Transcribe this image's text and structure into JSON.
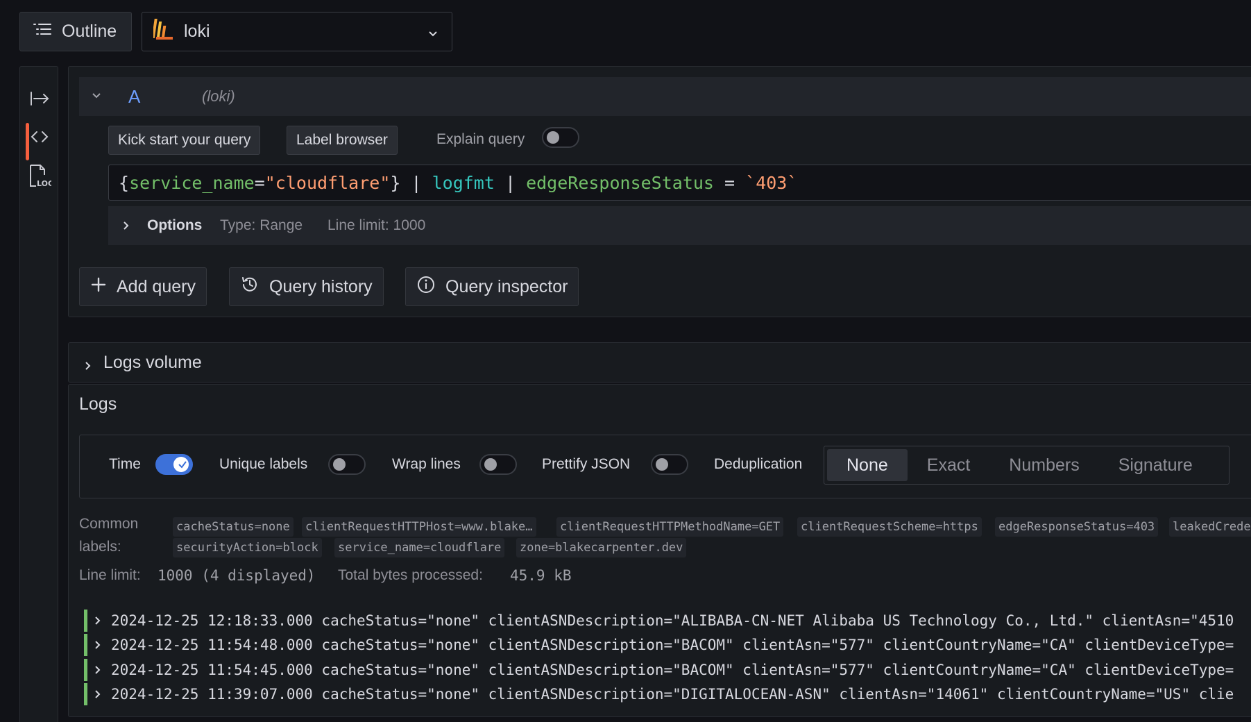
{
  "toolbar": {
    "outline_label": "Outline",
    "datasource": "loki"
  },
  "query": {
    "ref_id": "A",
    "datasource_label": "(loki)",
    "kick_start_label": "Kick start your query",
    "label_browser_label": "Label browser",
    "explain_label": "Explain query",
    "explain_on": false,
    "expr_parts": {
      "p1": "{",
      "label": "service_name",
      "p2": "=",
      "value": "\"cloudflare\"",
      "p3": "} | ",
      "fn": "logfmt",
      "p4": " | ",
      "field": "edgeResponseStatus",
      "p5": " = ",
      "cmp": "`403`"
    },
    "options_label": "Options",
    "options_type": "Type: Range",
    "options_limit": "Line limit: 1000"
  },
  "actions": {
    "add_query": "Add query",
    "query_history": "Query history",
    "query_inspector": "Query inspector"
  },
  "logs_volume": {
    "title": "Logs volume"
  },
  "logs": {
    "title": "Logs",
    "controls": {
      "time": "Time",
      "time_on": true,
      "unique_labels": "Unique labels",
      "wrap_lines": "Wrap lines",
      "prettify_json": "Prettify JSON",
      "deduplication": "Deduplication",
      "dedup_options": [
        "None",
        "Exact",
        "Numbers",
        "Signature"
      ],
      "dedup_selected": "None"
    },
    "common_labels_title_1": "Common",
    "common_labels_title_2": "labels:",
    "common_labels_row1": [
      "cacheStatus=none",
      "clientRequestHTTPHost=www.blake…",
      "clientRequestHTTPMethodName=GET",
      "clientRequestScheme=https",
      "edgeResponseStatus=403",
      "leakedCrede"
    ],
    "common_labels_row2": [
      "securityAction=block",
      "service_name=cloudflare",
      "zone=blakecarpenter.dev"
    ],
    "line_limit_key": "Line limit:",
    "line_limit_value": "1000 (4 displayed)",
    "bytes_key": "Total bytes processed:",
    "bytes_value": "45.9 kB",
    "rows": [
      "2024-12-25 12:18:33.000 cacheStatus=\"none\" clientASNDescription=\"ALIBABA-CN-NET Alibaba US Technology Co., Ltd.\" clientAsn=\"4510",
      "2024-12-25 11:54:48.000 cacheStatus=\"none\" clientASNDescription=\"BACOM\" clientAsn=\"577\" clientCountryName=\"CA\" clientDeviceType=",
      "2024-12-25 11:54:45.000 cacheStatus=\"none\" clientASNDescription=\"BACOM\" clientAsn=\"577\" clientCountryName=\"CA\" clientDeviceType=",
      "2024-12-25 11:39:07.000 cacheStatus=\"none\" clientASNDescription=\"DIGITALOCEAN-ASN\" clientAsn=\"14061\" clientCountryName=\"US\" clie"
    ]
  },
  "colors": {
    "accent": "#3d71d9",
    "active_tab": "#f55f3e",
    "log_level_bar": "#73bf69"
  }
}
